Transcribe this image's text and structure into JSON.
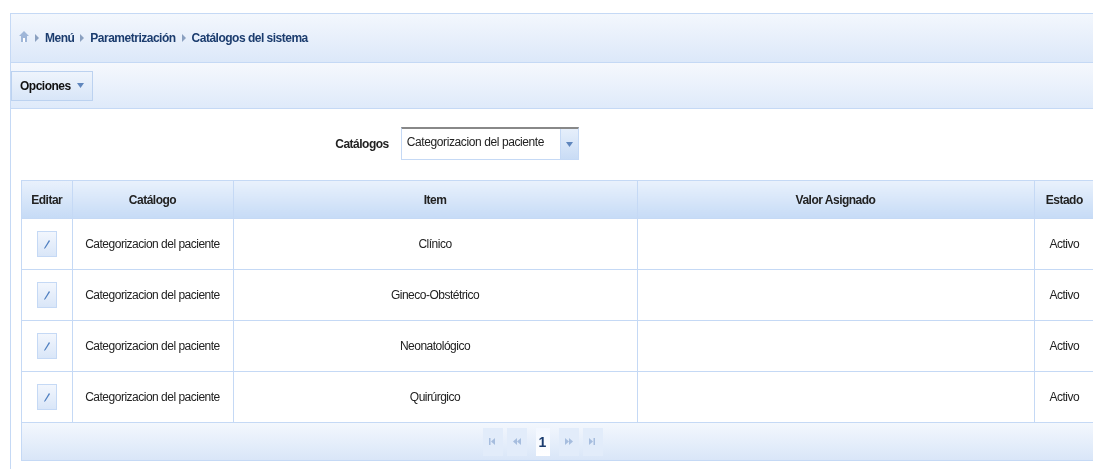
{
  "breadcrumb": [
    "Menú",
    "Parametrización",
    "Catálogos del sistema"
  ],
  "toolbar": {
    "menu_label": "Opciones"
  },
  "filter": {
    "label": "Catálogos",
    "value": "Categorizacion del paciente"
  },
  "table": {
    "columns": [
      "Editar",
      "Catálogo",
      "Item",
      "Valor Asignado",
      "Estado"
    ],
    "rows": [
      {
        "catalog": "Categorizacion del paciente",
        "item": "Clínico",
        "value": "",
        "status": "Activo"
      },
      {
        "catalog": "Categorizacion del paciente",
        "item": "Gineco-Obstétrico",
        "value": "",
        "status": "Activo"
      },
      {
        "catalog": "Categorizacion del paciente",
        "item": "Neonatológico",
        "value": "",
        "status": "Activo"
      },
      {
        "catalog": "Categorizacion del paciente",
        "item": "Quirúrgico",
        "value": "",
        "status": "Activo"
      }
    ]
  },
  "pager": [
    {
      "kind": "first",
      "disabled": true
    },
    {
      "kind": "prev",
      "disabled": true
    },
    {
      "kind": "page",
      "label": "1",
      "selected": true
    },
    {
      "kind": "next",
      "disabled": true
    },
    {
      "kind": "last",
      "disabled": true
    }
  ]
}
